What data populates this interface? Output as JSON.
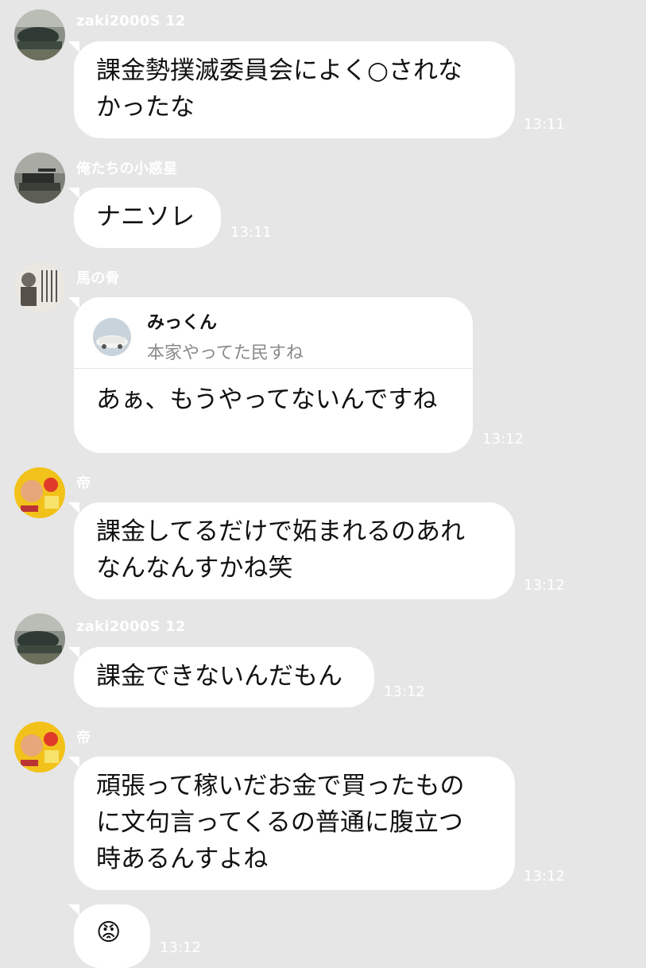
{
  "messages": [
    {
      "sender": "zaki2000S 12",
      "text": "課金勢撲滅委員会によく○されな\nかったな",
      "time": "13:11"
    },
    {
      "sender": "俺たちの小惑星",
      "text": "ナニソレ",
      "time": "13:11"
    },
    {
      "sender": "馬の骨",
      "quote_name": "みっくん",
      "quote_text": "本家やってた民すね",
      "text": "あぁ、もうやってないんですね",
      "time": "13:12"
    },
    {
      "sender": "帝",
      "text": "課金してるだけで妬まれるのあれ\nなんなんすかね笑",
      "time": "13:12"
    },
    {
      "sender": "zaki2000S 12",
      "text": "課金できないんだもん",
      "time": "13:12"
    },
    {
      "sender": "帝",
      "text": "頑張って稼いだお金で買ったもの\nに文句言ってくるの普通に腹立つ\n時あるんすよね",
      "time": "13:12"
    },
    {
      "emoji": "😡",
      "time": "13:12"
    }
  ]
}
